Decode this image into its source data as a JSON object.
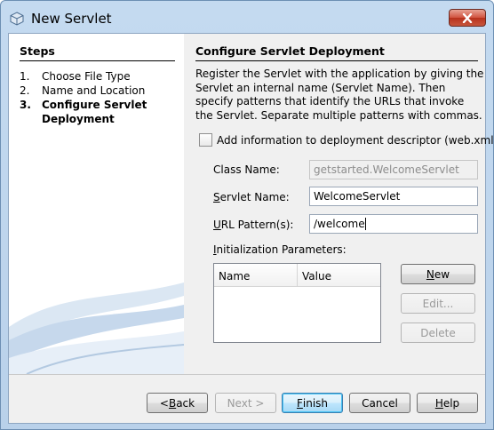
{
  "window": {
    "title": "New Servlet"
  },
  "steps": {
    "heading": "Steps",
    "items": [
      {
        "num": "1.",
        "label": "Choose File Type"
      },
      {
        "num": "2.",
        "label": "Name and Location"
      },
      {
        "num": "3.",
        "label_line1": "Configure Servlet",
        "label_line2": "Deployment"
      }
    ]
  },
  "main": {
    "heading": "Configure Servlet Deployment",
    "description": "Register the Servlet with the application by giving the Servlet an internal name (Servlet Name). Then specify patterns that identify the URLs that invoke the Servlet. Separate multiple patterns with commas.",
    "add_to_descriptor_label": "Add information to deployment descriptor (web.xml)",
    "add_to_descriptor_checked": false,
    "class_name_label": "Class Name:",
    "class_name_value": "getstarted.WelcomeServlet",
    "servlet_name_label_mnemonic": "S",
    "servlet_name_label_rest": "ervlet Name:",
    "servlet_name_value": "WelcomeServlet",
    "url_pattern_label_mnemonic": "U",
    "url_pattern_label_rest": "RL Pattern(s):",
    "url_pattern_value": "/welcome",
    "init_params_label_mnemonic": "I",
    "init_params_label_rest": "nitialization Parameters:",
    "params_columns": [
      "Name",
      "Value"
    ],
    "new_button_mnemonic": "N",
    "new_button_rest": "ew",
    "edit_button": "Edit...",
    "delete_button": "Delete"
  },
  "footer": {
    "back_lt": "< ",
    "back_mnemonic": "B",
    "back_rest": "ack",
    "next": "Next >",
    "finish_mnemonic": "F",
    "finish_rest": "inish",
    "cancel": "Cancel",
    "help_mnemonic": "H",
    "help_rest": "elp"
  },
  "colors": {
    "accent_blue": "#3c7fb1",
    "title_bar": "#c4daf0",
    "close_red": "#c7553c"
  }
}
